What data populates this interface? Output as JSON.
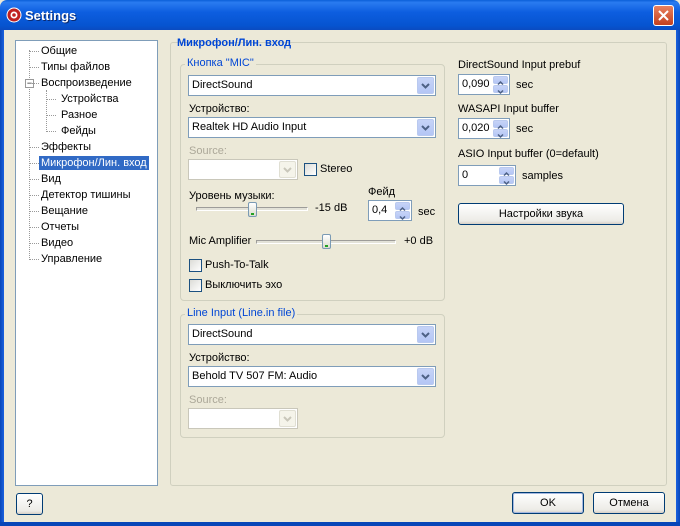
{
  "window": {
    "title": "Settings"
  },
  "tree": {
    "items": [
      {
        "label": "Общие",
        "level": 1
      },
      {
        "label": "Типы файлов",
        "level": 1
      },
      {
        "label": "Воспроизведение",
        "level": 1
      },
      {
        "label": "Устройства",
        "level": 2
      },
      {
        "label": "Разное",
        "level": 2
      },
      {
        "label": "Фейды",
        "level": 2
      },
      {
        "label": "Эффекты",
        "level": 1
      },
      {
        "label": "Микрофон/Лин. вход",
        "level": 1,
        "selected": true
      },
      {
        "label": "Вид",
        "level": 1
      },
      {
        "label": "Детектор тишины",
        "level": 1
      },
      {
        "label": "Вещание",
        "level": 1
      },
      {
        "label": "Отчеты",
        "level": 1
      },
      {
        "label": "Видео",
        "level": 1
      },
      {
        "label": "Управление",
        "level": 1
      }
    ],
    "expander_symbol": "−"
  },
  "panel": {
    "title": "Микрофон/Лин. вход"
  },
  "mic": {
    "group_label": "Кнопка \"MIC\"",
    "driver_value": "DirectSound",
    "device_label": "Устройство:",
    "device_value": "Realtek HD Audio Input",
    "source_label": "Source:",
    "stereo_label": "Stereo",
    "music_level_label": "Уровень музыки:",
    "music_level_value": "-15 dB",
    "music_level_fraction": 0.5,
    "fade_label": "Фейд",
    "fade_value": "0,4",
    "fade_unit": "sec",
    "mic_amp_label": "Mic Amplifier",
    "mic_amp_value": "+0 dB",
    "mic_amp_fraction": 0.5,
    "ptt_label": "Push-To-Talk",
    "mute_echo_label": "Выключить эхо"
  },
  "line": {
    "group_label": "Line Input (Line.in file)",
    "driver_value": "DirectSound",
    "device_label": "Устройство:",
    "device_value": "Behold TV 507 FM: Audio",
    "source_label": "Source:"
  },
  "buffers": {
    "ds_label": "DirectSound Input prebuf",
    "ds_value": "0,090",
    "ds_unit": "sec",
    "wasapi_label": "WASAPI Input buffer",
    "wasapi_value": "0,020",
    "wasapi_unit": "sec",
    "asio_label": "ASIO Input buffer (0=default)",
    "asio_value": "0",
    "asio_unit": "samples",
    "sound_settings_button": "Настройки звука"
  },
  "footer": {
    "help": "?",
    "ok": "OK",
    "cancel": "Отмена"
  }
}
